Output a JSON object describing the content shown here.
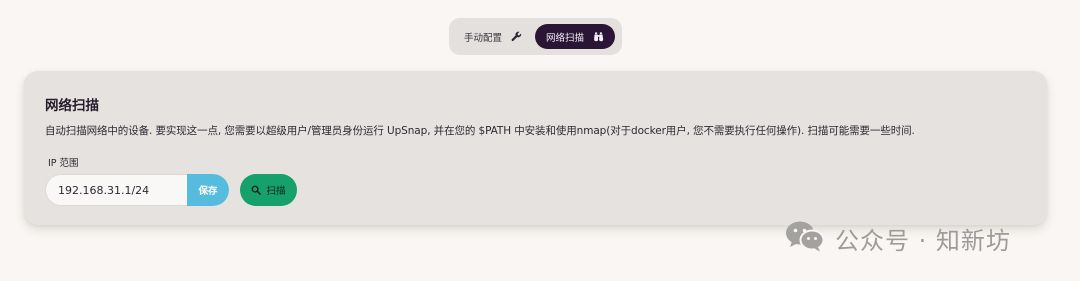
{
  "tabs": {
    "manual_label": "手动配置",
    "manual_icon": "wrench-icon",
    "scan_label": "网络扫描",
    "scan_icon": "binoculars-icon",
    "active": "scan"
  },
  "card": {
    "title": "网络扫描",
    "description": "自动扫描网络中的设备. 要实现这一点, 您需要以超级用户/管理员身份运行 UpSnap, 并在您的 $PATH 中安装和使用nmap(对于docker用户, 您不需要执行任何操作). 扫描可能需要一些时间.",
    "ip_range_label": "IP 范围",
    "ip_range_value": "192.168.31.1/24",
    "save_label": "保存",
    "scan_label": "扫描",
    "scan_icon": "search-icon"
  },
  "colors": {
    "page_bg": "#f9f6f3",
    "card_bg": "#e6e2df",
    "active_tab": "#2b1534",
    "save_button": "#56bcdd",
    "scan_button": "#16a06a"
  },
  "watermark": {
    "text": "公众号 · 知新坊",
    "icon": "wechat-icon"
  }
}
